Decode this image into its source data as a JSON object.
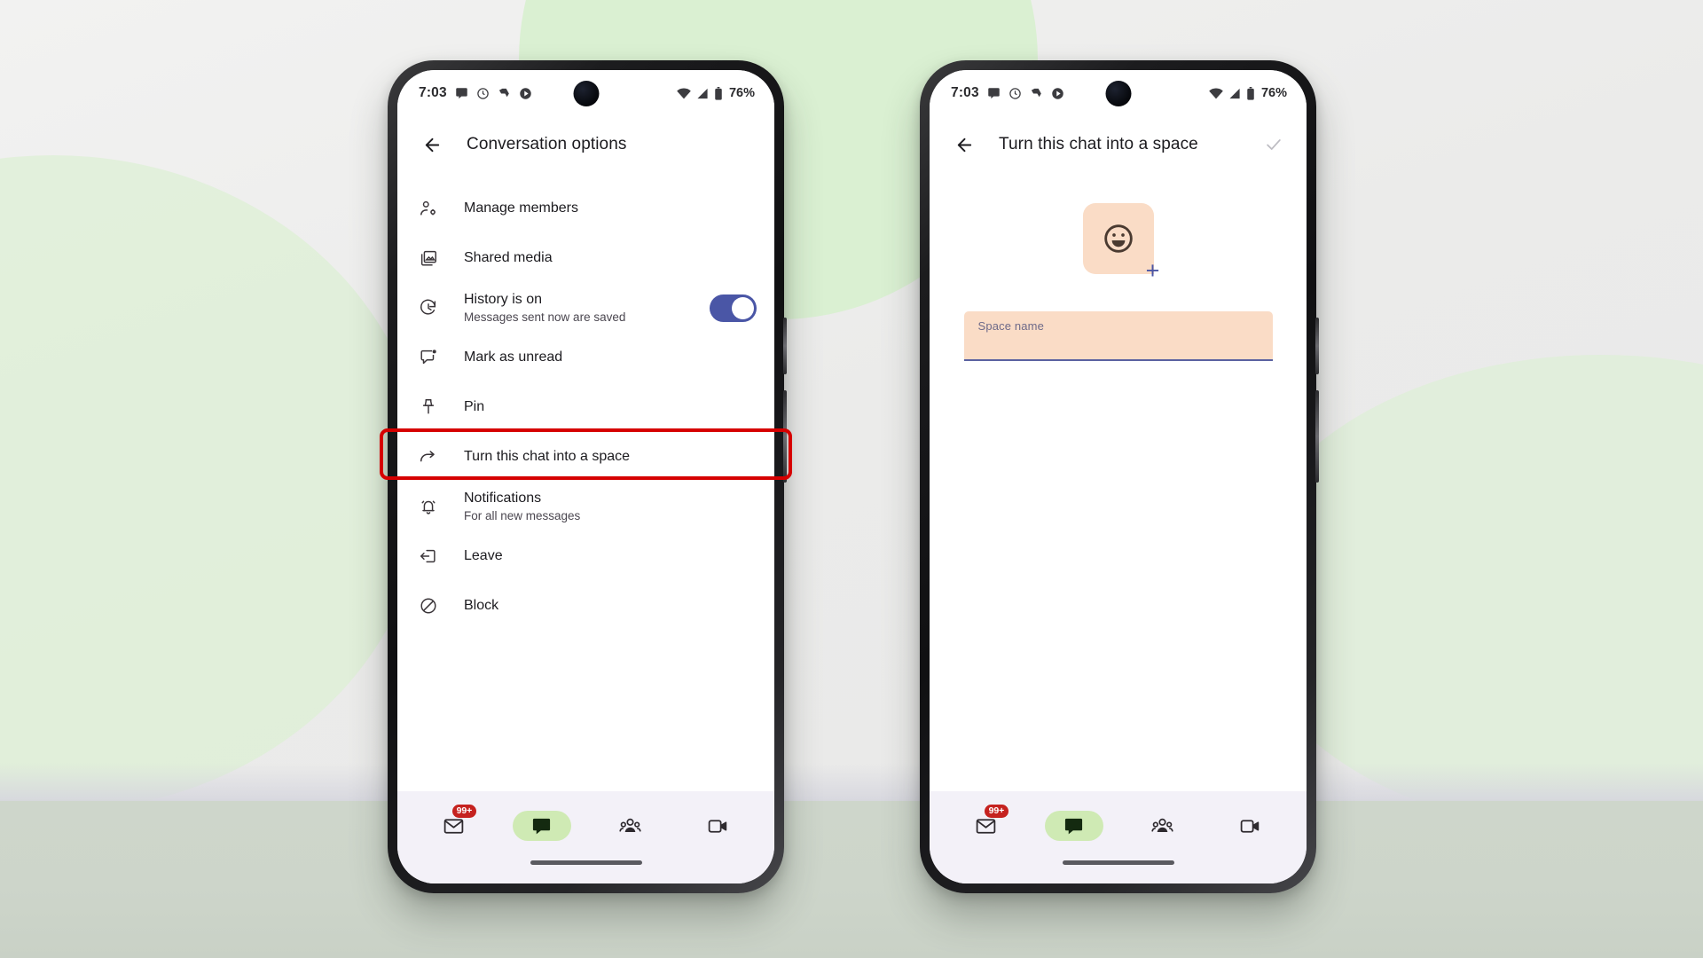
{
  "background": {
    "page_bg": "#ebebea",
    "blob_green": "#d8f0cf",
    "floor": "#ced6cb"
  },
  "status_bar": {
    "time": "7:03",
    "left_icons": [
      "chat-bubble-icon",
      "clock-alarm-icon",
      "drive-icon",
      "play-store-icon"
    ],
    "right_icons": [
      "wifi-icon",
      "cellular-signal-icon",
      "battery-icon"
    ],
    "battery_text": "76%"
  },
  "phone_left": {
    "app_bar": {
      "back_icon": "back-arrow-icon",
      "title": "Conversation options"
    },
    "options": [
      {
        "icon": "manage-members-icon",
        "title": "Manage members",
        "subtitle": "",
        "control": "none"
      },
      {
        "icon": "shared-media-icon",
        "title": "Shared media",
        "subtitle": "",
        "control": "none"
      },
      {
        "icon": "history-clock-icon",
        "title": "History is on",
        "subtitle": "Messages sent now are saved",
        "control": "toggle",
        "toggle_on": true
      },
      {
        "icon": "mark-unread-icon",
        "title": "Mark as unread",
        "subtitle": "",
        "control": "none"
      },
      {
        "icon": "pin-icon",
        "title": "Pin",
        "subtitle": "",
        "control": "none"
      },
      {
        "icon": "turn-into-space-icon",
        "title": "Turn this chat into a space",
        "subtitle": "",
        "control": "none",
        "highlighted": true
      },
      {
        "icon": "notifications-bell-icon",
        "title": "Notifications",
        "subtitle": "For all new messages",
        "control": "none"
      },
      {
        "icon": "leave-icon",
        "title": "Leave",
        "subtitle": "",
        "control": "none"
      },
      {
        "icon": "block-icon",
        "title": "Block",
        "subtitle": "",
        "control": "none"
      }
    ],
    "highlight_color": "#d60000"
  },
  "phone_right": {
    "app_bar": {
      "back_icon": "back-arrow-icon",
      "title": "Turn this chat into a space",
      "confirm_icon": "checkmark-icon"
    },
    "avatar": {
      "emoji_icon": "smiley-face-icon",
      "add_icon": "plus-icon",
      "tile_color": "#fadcc6"
    },
    "space_name_field": {
      "label": "Space name",
      "value": "",
      "fill_color": "#fadcc6",
      "underline_color": "#5a61a1"
    }
  },
  "bottom_nav": {
    "items": [
      {
        "icon": "mail-icon",
        "label": "Mail",
        "active": false,
        "badge": "99+"
      },
      {
        "icon": "chat-icon",
        "label": "Chat",
        "active": true,
        "badge": ""
      },
      {
        "icon": "spaces-icon",
        "label": "Spaces",
        "active": false,
        "badge": ""
      },
      {
        "icon": "meet-video-icon",
        "label": "Meet",
        "active": false,
        "badge": ""
      }
    ],
    "active_pill_color": "#cfeab4",
    "badge_color": "#c5221f"
  }
}
